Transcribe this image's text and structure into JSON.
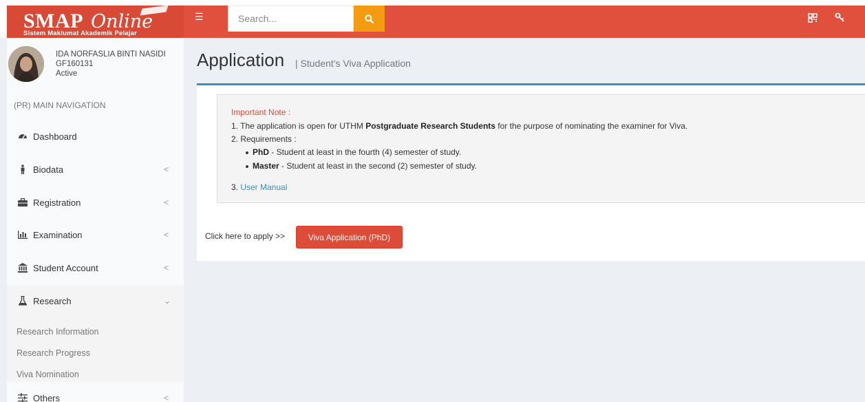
{
  "header": {
    "logo_main": "SMAP",
    "logo_script": "Online",
    "logo_subtitle": "Sistem Maklumat Akademik Pelajar",
    "search_placeholder": "Search..."
  },
  "user": {
    "name": "IDA NORFASLIA BINTI NASIDI",
    "id": "GF160131",
    "status": "Active"
  },
  "sidebar": {
    "header": "(PR) MAIN NAVIGATION",
    "items": [
      {
        "label": "Dashboard",
        "icon": "dashboard-icon",
        "has_children": false
      },
      {
        "label": "Biodata",
        "icon": "person-icon",
        "has_children": true
      },
      {
        "label": "Registration",
        "icon": "briefcase-icon",
        "has_children": true
      },
      {
        "label": "Examination",
        "icon": "bar-chart-icon",
        "has_children": true
      },
      {
        "label": "Student Account",
        "icon": "bank-icon",
        "has_children": true
      },
      {
        "label": "Research",
        "icon": "flask-icon",
        "has_children": true,
        "expanded": true
      },
      {
        "label": "Others",
        "icon": "sliders-icon",
        "has_children": true
      }
    ],
    "research_submenu": [
      "Research Information",
      "Research Progress",
      "Viva Nomination"
    ]
  },
  "page": {
    "title": "Application",
    "subtitle": "| Student's Viva Application"
  },
  "note": {
    "title": "Important Note :",
    "line1_prefix": "1. The application is open for UTHM ",
    "line1_bold": "Postgraduate Research Students",
    "line1_suffix": " for the purpose of nominating the examiner for Viva.",
    "line2": "2. Requirements :",
    "req1_bold": "PhD",
    "req1_text": " - Student at least in the fourth (4) semester of study.",
    "req2_bold": "Master",
    "req2_text": " - Student at least in the second (2) semester of study.",
    "line3_prefix": "3. ",
    "line3_link": "User Manual"
  },
  "apply": {
    "label": "Click here to apply >>",
    "button": "Viva Application (PhD)"
  },
  "colors": {
    "navbar": "#e0503c",
    "logo_bg": "#d94a36",
    "search_button": "#f39c12",
    "box_border": "#3c8dbc",
    "apply_button": "#dd4b39"
  }
}
